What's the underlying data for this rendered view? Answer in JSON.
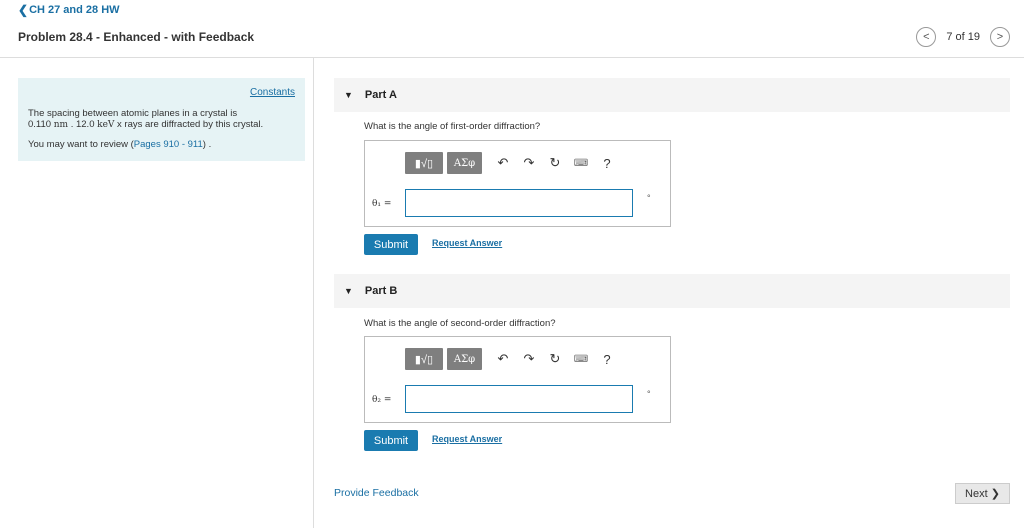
{
  "nav": {
    "back_label": "CH 27 and 28 HW",
    "problem_title": "Problem 28.4 - Enhanced - with Feedback",
    "pager_text": "7 of 19"
  },
  "info": {
    "constants_label": "Constants",
    "text_line1": "The spacing between atomic planes in a crystal is",
    "value": "0.110",
    "unit": "nm",
    "separator": ". 12.0",
    "energy_unit": "keV",
    "text_line2_rest": "x rays are diffracted by this crystal.",
    "review_prefix": "You may want to review (",
    "review_link": "Pages 910 - 911",
    "review_suffix": ") ."
  },
  "toolbar": {
    "templates_label": "▮√▯",
    "greek_label": "ΑΣφ",
    "undo_icon": "↶",
    "redo_icon": "↷",
    "reset_icon": "↻",
    "keyboard_icon": "⌨",
    "help_label": "?"
  },
  "parts": [
    {
      "label": "Part A",
      "question": "What is the angle of first-order diffraction?",
      "variable": "θ₁ =",
      "unit": "°",
      "submit_label": "Submit",
      "request_label": "Request Answer"
    },
    {
      "label": "Part B",
      "question": "What is the angle of second-order diffraction?",
      "variable": "θ₂ =",
      "unit": "°",
      "submit_label": "Submit",
      "request_label": "Request Answer"
    }
  ],
  "footer": {
    "feedback_label": "Provide Feedback",
    "next_label": "Next ❯"
  }
}
